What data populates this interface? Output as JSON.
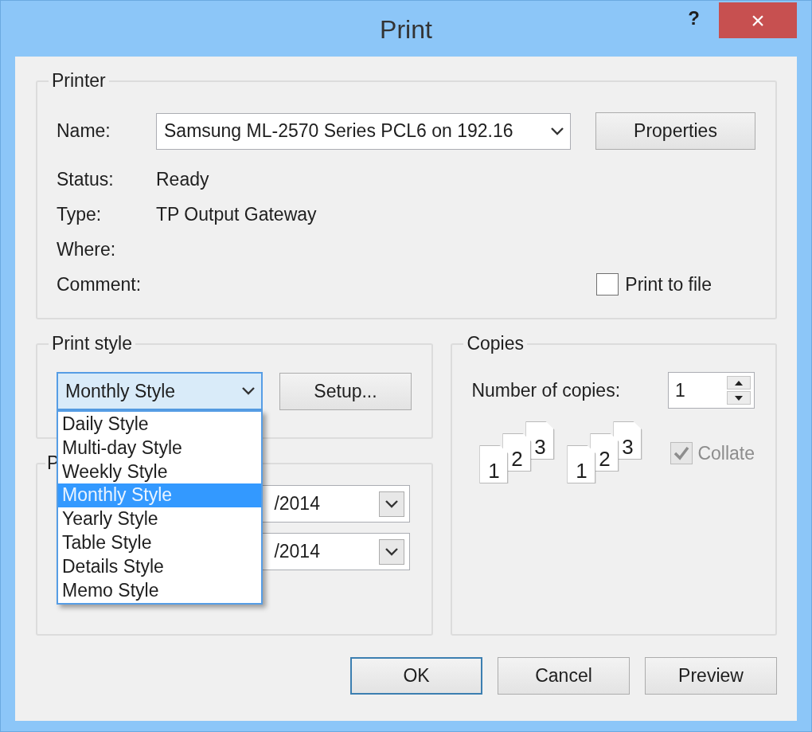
{
  "window": {
    "title": "Print",
    "help": "?",
    "close": "×"
  },
  "printer": {
    "group_label": "Printer",
    "name_label": "Name:",
    "name_value": "Samsung ML-2570 Series PCL6 on 192.16",
    "properties_button": "Properties",
    "info": [
      {
        "label": "Status:",
        "value": "Ready"
      },
      {
        "label": "Type:",
        "value": "TP Output Gateway"
      },
      {
        "label": "Where:"
      },
      {
        "label": "Comment:"
      }
    ],
    "print_to_file": {
      "label": "Print to file",
      "checked": false
    }
  },
  "print_style": {
    "group_label": "Print style",
    "value": "Monthly Style",
    "expanded": true,
    "setup_button": "Setup...",
    "options": [
      {
        "label": "Daily Style",
        "selected": false
      },
      {
        "label": "Multi-day Style",
        "selected": false
      },
      {
        "label": "Weekly Style",
        "selected": false
      },
      {
        "label": "Monthly Style",
        "selected": true
      },
      {
        "label": "Yearly Style",
        "selected": false
      },
      {
        "label": "Table Style",
        "selected": false
      },
      {
        "label": "Details Style",
        "selected": false
      },
      {
        "label": "Memo Style",
        "selected": false
      }
    ]
  },
  "print_range": {
    "group_label": "P",
    "fields": [
      {
        "value": "/2014"
      },
      {
        "value": "/2014"
      }
    ]
  },
  "copies": {
    "group_label": "Copies",
    "number_label": "Number of copies:",
    "number_value": "1",
    "page_stacks": [
      {
        "pages": [
          "1",
          "2",
          "3"
        ]
      },
      {
        "pages": [
          "1",
          "2",
          "3"
        ]
      }
    ],
    "collate": {
      "label": "Collate",
      "checked": true,
      "disabled": true
    }
  },
  "buttons": [
    {
      "label": "OK",
      "default": true
    },
    {
      "label": "Cancel",
      "default": false
    },
    {
      "label": "Preview",
      "default": false
    }
  ]
}
